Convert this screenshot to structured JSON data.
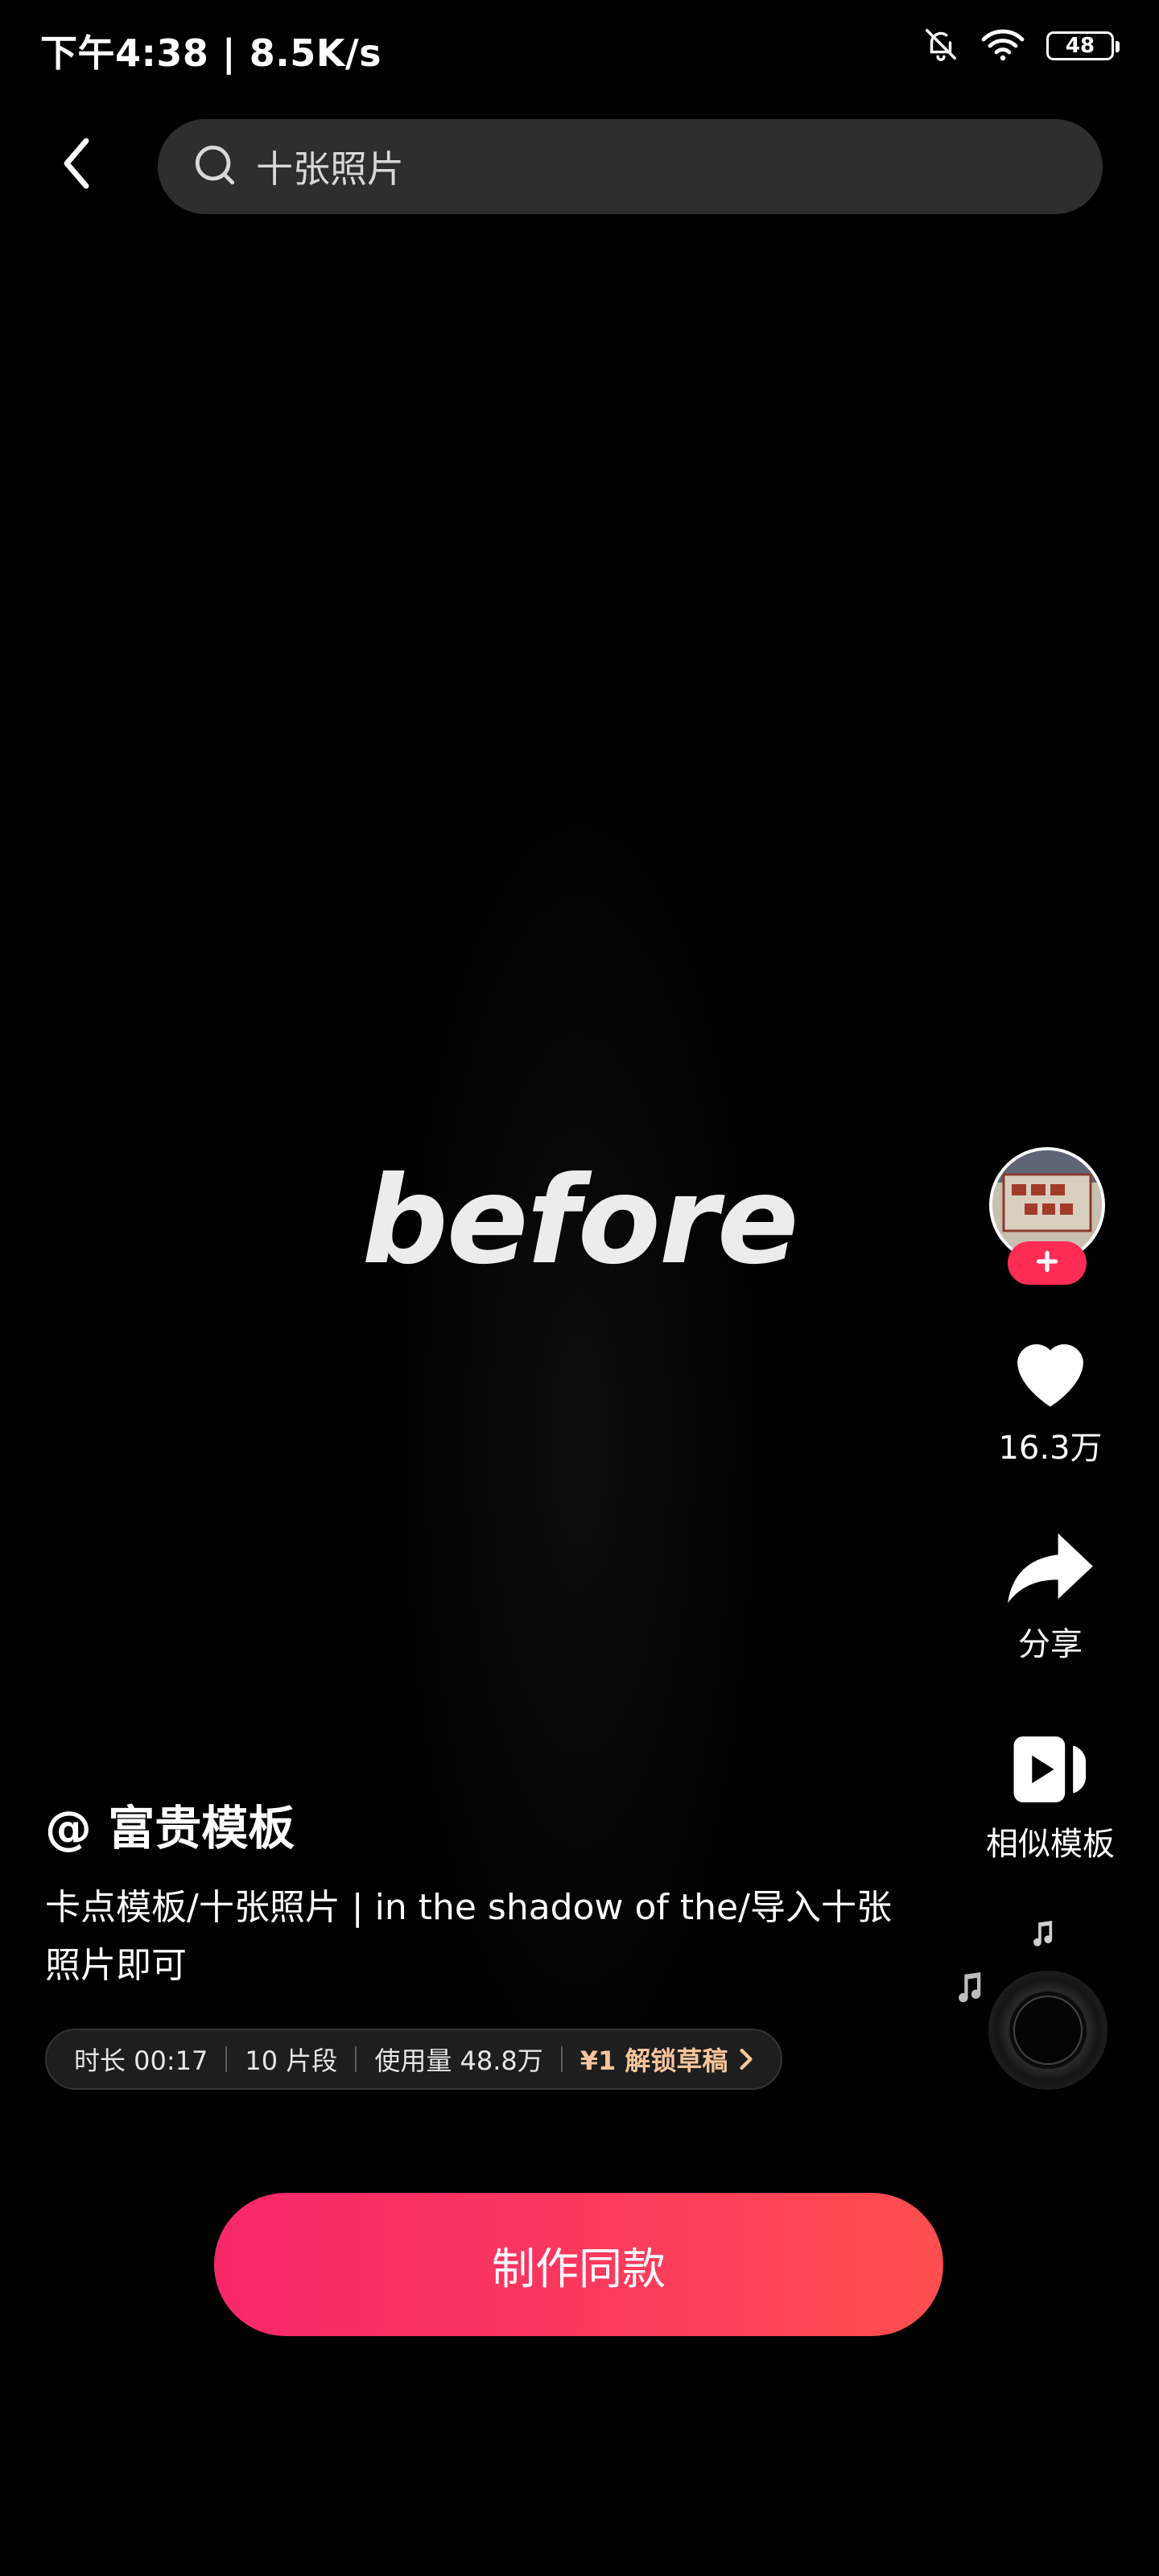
{
  "status_bar": {
    "time_speed": "下午4:38 | 8.5K/s",
    "battery": "48",
    "icons": [
      "mute-bell-icon",
      "wifi-icon",
      "battery-icon"
    ]
  },
  "header": {
    "back_icon": "chevron-left-icon",
    "search_icon": "search-icon",
    "search_text": "十张照片"
  },
  "video": {
    "overlay_word": "before"
  },
  "right_rail": {
    "like_count": "16.3万",
    "share_label": "分享",
    "similar_label": "相似模板"
  },
  "post": {
    "author": "@ 富贵模板",
    "description": "卡点模板/十张照片 | in the shadow of the/导入十张照片即可",
    "duration": "时长 00:17",
    "segments": "10 片段",
    "usage": "使用量 48.8万",
    "unlock": "¥1 解锁草稿"
  },
  "cta": {
    "label": "制作同款"
  },
  "colors": {
    "accent_red": "#fe2c55",
    "cta_gradient_start": "#f5286a",
    "cta_gradient_end": "#ff4f4f",
    "unlock_text": "#f7c59b",
    "search_bg": "#2e2e2e"
  }
}
